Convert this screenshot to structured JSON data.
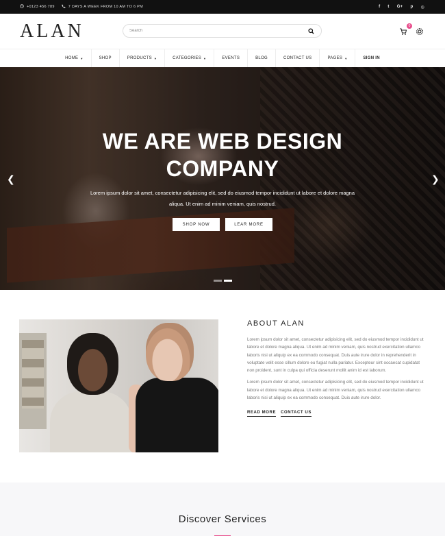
{
  "topbar": {
    "phone": "+0123 456 789",
    "hours": "7 DAYS A WEEK FROM 10 AM TO 6 PM",
    "social": [
      {
        "icon": "facebook-icon",
        "glyph": "f"
      },
      {
        "icon": "twitter-icon",
        "glyph": "t"
      },
      {
        "icon": "google-plus-icon",
        "glyph": "G+"
      },
      {
        "icon": "pinterest-icon",
        "glyph": "p"
      },
      {
        "icon": "instagram-icon",
        "glyph": "◎"
      }
    ]
  },
  "header": {
    "logo": "ALAN",
    "search_placeholder": "Search",
    "cart_count": "0"
  },
  "nav": {
    "items": [
      {
        "label": "HOME",
        "dropdown": true
      },
      {
        "label": "SHOP",
        "dropdown": false
      },
      {
        "label": "PRODUCTS",
        "dropdown": true
      },
      {
        "label": "CATEGORIES",
        "dropdown": true
      },
      {
        "label": "EVENTS",
        "dropdown": false
      },
      {
        "label": "BLOG",
        "dropdown": false
      },
      {
        "label": "CONTACT US",
        "dropdown": false
      },
      {
        "label": "PAGES",
        "dropdown": true
      },
      {
        "label": "SIGN IN",
        "dropdown": false
      }
    ]
  },
  "hero": {
    "title_line1": "WE ARE WEB DESIGN",
    "title_line2": "COMPANY",
    "text": "Lorem ipsum dolor sit amet, consectetur adipisicing elit, sed do eiusmod tempor incididunt ut labore et dolore magna aliqua. Ut enim ad minim veniam, quis nostrud.",
    "btn_shop": "SHOP NOW",
    "btn_learn": "LEAR MORE",
    "prev_glyph": "❮",
    "next_glyph": "❯"
  },
  "about": {
    "title": "ABOUT ALAN",
    "para1": "Lorem ipsum dolor sit amet, consectetur adipisicing elit, sed do eiusmod tempor incididunt ut labore et dolore magna aliqua. Ut enim ad minim veniam, quis nostrud exercitation ullamco laboris nisi ut aliquip ex ea commodo consequat. Duis aute irure dolor in reprehenderit in voluptate velit esse cillum dolore eu fugiat nulla pariatur. Excepteur sint occaecat cupidatat non proident, sunt in culpa qui officia deserunt mollit anim id est laborum.",
    "para2": "Lorem ipsum dolor sit amet, consectetur adipisicing elit, sed do eiusmod tempor incididunt ut labore et dolore magna aliqua. Ut enim ad minim veniam, quis nostrud exercitation ullamco laboris nisi ut aliquip ex ea commodo consequat. Duis aute irure dolor.",
    "read_more": "READ MORE",
    "contact_us": "CONTACT US"
  },
  "services": {
    "title": "Discover Services"
  },
  "colors": {
    "accent": "#e84c8b",
    "topbar": "#111111"
  }
}
